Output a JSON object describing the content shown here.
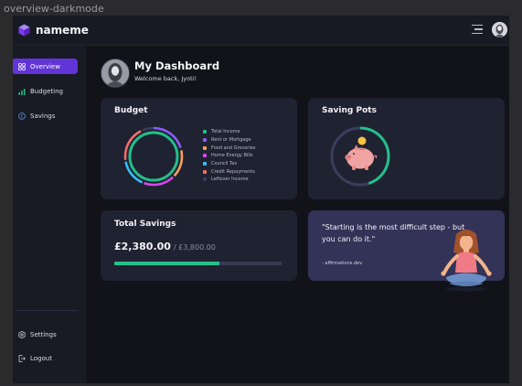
{
  "window": {
    "title": "overview-darkmode"
  },
  "header": {
    "brand": "nameme"
  },
  "sidebar": {
    "items": [
      {
        "label": "Overview",
        "active": true
      },
      {
        "label": "Budgeting",
        "active": false
      },
      {
        "label": "Savings",
        "active": false
      }
    ],
    "bottom": [
      {
        "label": "Settings"
      },
      {
        "label": "Logout"
      }
    ]
  },
  "dashboard": {
    "title": "My Dashboard",
    "welcome": "Welcome back, Jyoti!"
  },
  "budget": {
    "title": "Budget",
    "legend": [
      {
        "label": "Total Income",
        "color": "#22c08a"
      },
      {
        "label": "Rent or Mortgage",
        "color": "#8b5cf6"
      },
      {
        "label": "Food and Groceries",
        "color": "#f59e5b"
      },
      {
        "label": "Home Energy Bills",
        "color": "#d946ef"
      },
      {
        "label": "Council Tax",
        "color": "#38bdf8"
      },
      {
        "label": "Credit Repayments",
        "color": "#f26d6d"
      },
      {
        "label": "Leftover Income",
        "color": "#3a3f5c"
      }
    ]
  },
  "saving_pots": {
    "title": "Saving Pots",
    "icon": "piggy-bank-icon",
    "progress": 0.45
  },
  "total_savings": {
    "title": "Total Savings",
    "amount": "£2,380.00",
    "target": "/ £3,800.00",
    "progress": 0.626
  },
  "quote": {
    "text": "\"Starting is the most difficult step - but you can do it.\"",
    "source": "- affirmations.dev"
  },
  "colors": {
    "accent": "#6234d8",
    "positive": "#22c08a",
    "background": "#111318",
    "card": "#1f2231",
    "quote_card": "#333357"
  }
}
